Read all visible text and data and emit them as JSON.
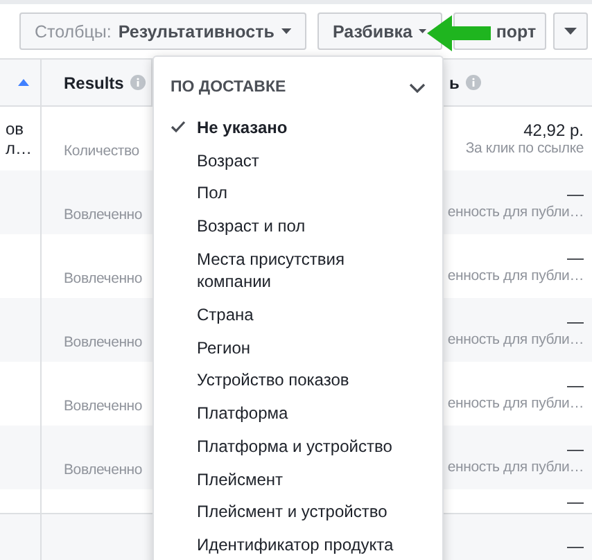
{
  "toolbar": {
    "columns_button": {
      "prefix": "Столбцы:",
      "value": "Результативность"
    },
    "breakdown_button": {
      "label": "Разбивка"
    },
    "export_button": {
      "label": "порт"
    }
  },
  "table": {
    "columns": [
      {
        "sorted": true,
        "info": false
      },
      {
        "label": "Results",
        "sorted": false,
        "info": true
      },
      {
        "label": "ь",
        "sorted": false,
        "info": true
      }
    ],
    "rows": [
      {
        "first": [
          "ов",
          "л…"
        ],
        "results": "Количество",
        "value": "42,92 р.",
        "note": "За клик по ссылке"
      },
      {
        "first": [],
        "results": "Вовлеченно",
        "value": "—",
        "note": "енность для публи…"
      },
      {
        "first": [],
        "results": "Вовлеченно",
        "value": "—",
        "note": "енность для публи…"
      },
      {
        "first": [],
        "results": "Вовлеченно",
        "value": "—",
        "note": "енность для публи…"
      },
      {
        "first": [],
        "results": "Вовлеченно",
        "value": "—",
        "note": "енность для публи…"
      },
      {
        "first": [],
        "results": "Вовлеченно",
        "value": "—",
        "note": "енность для публи…"
      },
      {
        "first": [],
        "results": "",
        "value": "—",
        "note": ""
      },
      {
        "first": [],
        "results": "",
        "value": "—",
        "note": ""
      }
    ]
  },
  "menu": {
    "section": {
      "title": "ПО ДОСТАВКЕ",
      "expanded": true
    },
    "items": [
      {
        "label": "Не указано",
        "selected": true
      },
      {
        "label": "Возраст",
        "selected": false
      },
      {
        "label": "Пол",
        "selected": false
      },
      {
        "label": "Возраст и пол",
        "selected": false
      },
      {
        "label": "Места присутствия компании",
        "selected": false
      },
      {
        "label": "Страна",
        "selected": false
      },
      {
        "label": "Регион",
        "selected": false
      },
      {
        "label": "Устройство показов",
        "selected": false
      },
      {
        "label": "Платформа",
        "selected": false
      },
      {
        "label": "Платформа и устройство",
        "selected": false
      },
      {
        "label": "Плейсмент",
        "selected": false
      },
      {
        "label": "Плейсмент и устройство",
        "selected": false
      },
      {
        "label": "Идентификатор продукта",
        "selected": false
      }
    ]
  }
}
